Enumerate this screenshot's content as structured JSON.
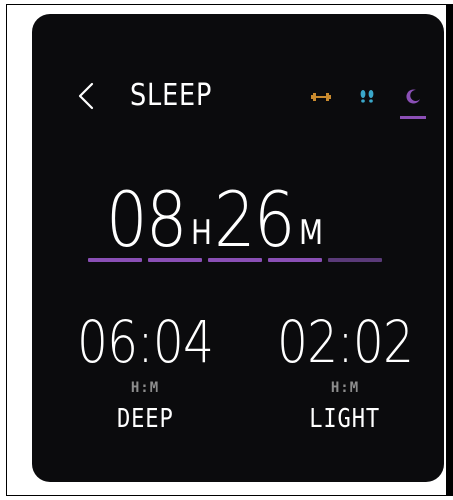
{
  "header": {
    "title": "SLEEP",
    "icons": {
      "back": "chevron-left-icon",
      "fitness": "dumbbell-icon",
      "steps": "footprints-icon",
      "sleep": "moon-icon"
    },
    "active_tab": "sleep"
  },
  "duration": {
    "hours": "08",
    "hours_unit": "H",
    "minutes": "26",
    "minutes_unit": "M"
  },
  "progress": {
    "segments_total": 5,
    "segments_filled": 4
  },
  "stats": {
    "deep": {
      "value": "06:04",
      "unit": "H:M",
      "label": "DEEP"
    },
    "light": {
      "value": "02:02",
      "unit": "H:M",
      "label": "LIGHT"
    }
  },
  "colors": {
    "background": "#0b0b0d",
    "text": "#ffffff",
    "accent_purple": "#8a4fb5",
    "accent_purple_dim": "#5a3a78",
    "fitness_icon": "#c98a2e",
    "steps_icon": "#3aa7c9",
    "muted_text": "#8c8c8c"
  }
}
